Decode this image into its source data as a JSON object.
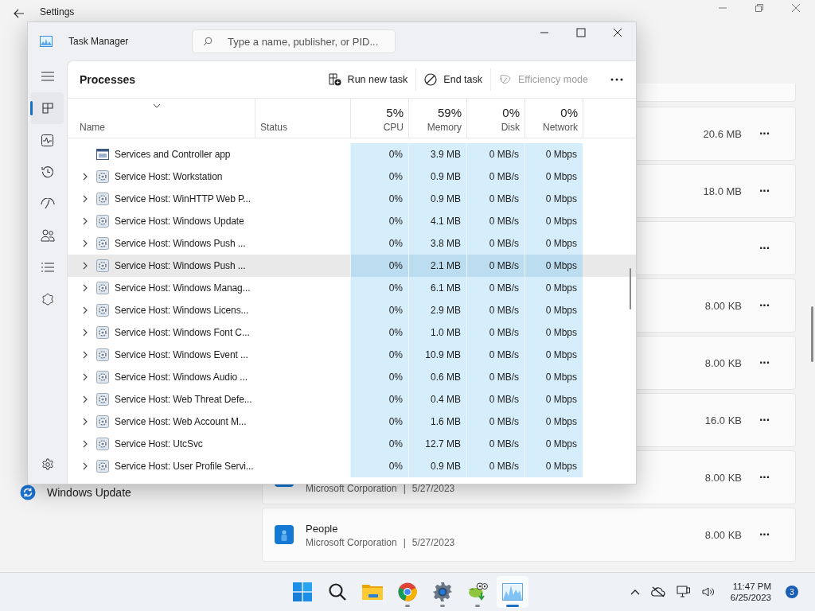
{
  "settings": {
    "title": "Settings",
    "nav_item": "Windows Update",
    "apps": [
      {
        "size": "20.6 MB",
        "more": "···"
      },
      {
        "size": "18.0 MB",
        "more": "···"
      },
      {
        "more": "···"
      },
      {
        "size": "8.00 KB",
        "more": "···"
      },
      {
        "size": "8.00 KB",
        "more": "···"
      },
      {
        "size": "16.0 KB",
        "more": "···"
      },
      {
        "publisher": "Microsoft Corporation",
        "separator": "|",
        "date": "5/27/2023",
        "size": "8.00 KB",
        "more": "···"
      },
      {
        "name": "People",
        "publisher": "Microsoft Corporation",
        "separator": "|",
        "date": "5/27/2023",
        "size": "8.00 KB",
        "more": "···"
      }
    ]
  },
  "task_manager": {
    "title": "Task Manager",
    "search": {
      "placeholder": "Type a name, publisher, or PID..."
    },
    "nav": [
      {
        "kind": "menu",
        "selected": false
      },
      {
        "kind": "processes",
        "selected": true
      },
      {
        "kind": "performance",
        "selected": false
      },
      {
        "kind": "history",
        "selected": false
      },
      {
        "kind": "startup",
        "selected": false
      },
      {
        "kind": "users",
        "selected": false
      },
      {
        "kind": "details",
        "selected": false
      },
      {
        "kind": "services",
        "selected": false
      },
      {
        "kind": "settings",
        "selected": false
      }
    ],
    "page_title": "Processes",
    "toolbar": [
      {
        "kind": "run",
        "label": "Run new task",
        "disabled": false
      },
      {
        "kind": "end",
        "label": "End task",
        "disabled": false
      },
      {
        "kind": "efficiency",
        "label": "Efficiency mode",
        "disabled": true
      }
    ],
    "columns": [
      {
        "label": "Name"
      },
      {
        "label": "Status"
      },
      {
        "label": "CPU",
        "total": "5%"
      },
      {
        "label": "Memory",
        "total": "59%"
      },
      {
        "label": "Disk",
        "total": "0%"
      },
      {
        "label": "Network",
        "total": "0%"
      }
    ],
    "rows": [
      {
        "name": "Services and Controller app",
        "expandable": false,
        "hovered": false,
        "cpu": "0%",
        "memory": "3.9 MB",
        "disk": "0 MB/s",
        "network": "0 Mbps"
      },
      {
        "name": "Service Host: Workstation",
        "expandable": true,
        "hovered": false,
        "cpu": "0%",
        "memory": "0.9 MB",
        "disk": "0 MB/s",
        "network": "0 Mbps"
      },
      {
        "name": "Service Host: WinHTTP Web P...",
        "expandable": true,
        "hovered": false,
        "cpu": "0%",
        "memory": "0.9 MB",
        "disk": "0 MB/s",
        "network": "0 Mbps"
      },
      {
        "name": "Service Host: Windows Update",
        "expandable": true,
        "hovered": false,
        "cpu": "0%",
        "memory": "4.1 MB",
        "disk": "0 MB/s",
        "network": "0 Mbps"
      },
      {
        "name": "Service Host: Windows Push ...",
        "expandable": true,
        "hovered": false,
        "cpu": "0%",
        "memory": "3.8 MB",
        "disk": "0 MB/s",
        "network": "0 Mbps"
      },
      {
        "name": "Service Host: Windows Push ...",
        "expandable": true,
        "hovered": true,
        "cpu": "0%",
        "memory": "2.1 MB",
        "disk": "0 MB/s",
        "network": "0 Mbps"
      },
      {
        "name": "Service Host: Windows Manag...",
        "expandable": true,
        "hovered": false,
        "cpu": "0%",
        "memory": "6.1 MB",
        "disk": "0 MB/s",
        "network": "0 Mbps"
      },
      {
        "name": "Service Host: Windows Licens...",
        "expandable": true,
        "hovered": false,
        "cpu": "0%",
        "memory": "2.9 MB",
        "disk": "0 MB/s",
        "network": "0 Mbps"
      },
      {
        "name": "Service Host: Windows Font C...",
        "expandable": true,
        "hovered": false,
        "cpu": "0%",
        "memory": "1.0 MB",
        "disk": "0 MB/s",
        "network": "0 Mbps"
      },
      {
        "name": "Service Host: Windows Event ...",
        "expandable": true,
        "hovered": false,
        "cpu": "0%",
        "memory": "10.9 MB",
        "disk": "0 MB/s",
        "network": "0 Mbps"
      },
      {
        "name": "Service Host: Windows Audio ...",
        "expandable": true,
        "hovered": false,
        "cpu": "0%",
        "memory": "0.6 MB",
        "disk": "0 MB/s",
        "network": "0 Mbps"
      },
      {
        "name": "Service Host: Web Threat Defe...",
        "expandable": true,
        "hovered": false,
        "cpu": "0%",
        "memory": "0.4 MB",
        "disk": "0 MB/s",
        "network": "0 Mbps"
      },
      {
        "name": "Service Host: Web Account M...",
        "expandable": true,
        "hovered": false,
        "cpu": "0%",
        "memory": "1.6 MB",
        "disk": "0 MB/s",
        "network": "0 Mbps"
      },
      {
        "name": "Service Host: UtcSvc",
        "expandable": true,
        "hovered": false,
        "cpu": "0%",
        "memory": "12.7 MB",
        "disk": "0 MB/s",
        "network": "0 Mbps"
      },
      {
        "name": "Service Host: User Profile Servi...",
        "expandable": true,
        "hovered": false,
        "cpu": "0%",
        "memory": "0.9 MB",
        "disk": "0 MB/s",
        "network": "0 Mbps"
      }
    ]
  },
  "taskbar": {
    "apps": [
      {
        "kind": "start",
        "running": false,
        "active": false
      },
      {
        "kind": "search",
        "running": false,
        "active": false
      },
      {
        "kind": "explorer",
        "running": false,
        "active": false
      },
      {
        "kind": "browser",
        "running": true,
        "active": false
      },
      {
        "kind": "settings",
        "running": true,
        "active": false
      },
      {
        "kind": "editor",
        "running": true,
        "active": false
      },
      {
        "kind": "taskmanager",
        "running": true,
        "active": true
      }
    ],
    "time": "11:47 PM",
    "date": "6/25/2023",
    "notifications": "3"
  }
}
